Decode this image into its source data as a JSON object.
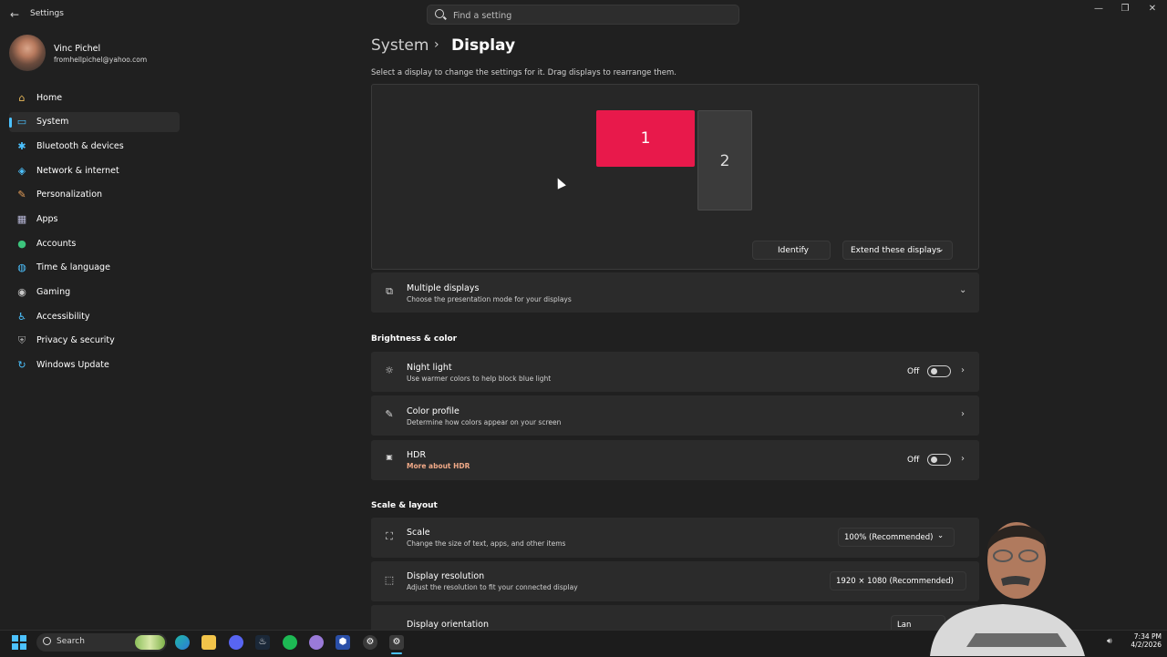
{
  "app": {
    "title": "Settings"
  },
  "search": {
    "placeholder": "Find a setting"
  },
  "user": {
    "name": "Vinc Pichel",
    "email": "fromhellpichel@yahoo.com"
  },
  "nav": [
    {
      "label": "Home",
      "icon": "home-icon"
    },
    {
      "label": "System",
      "icon": "system-icon",
      "active": true
    },
    {
      "label": "Bluetooth & devices",
      "icon": "bluetooth-icon"
    },
    {
      "label": "Network & internet",
      "icon": "wifi-icon"
    },
    {
      "label": "Personalization",
      "icon": "brush-icon"
    },
    {
      "label": "Apps",
      "icon": "apps-icon"
    },
    {
      "label": "Accounts",
      "icon": "accounts-icon"
    },
    {
      "label": "Time & language",
      "icon": "globe-icon"
    },
    {
      "label": "Gaming",
      "icon": "gamepad-icon"
    },
    {
      "label": "Accessibility",
      "icon": "accessibility-icon"
    },
    {
      "label": "Privacy & security",
      "icon": "shield-icon"
    },
    {
      "label": "Windows Update",
      "icon": "update-icon"
    }
  ],
  "breadcrumb": {
    "parent": "System",
    "separator": "›",
    "current": "Display"
  },
  "display_hint": "Select a display to change the settings for it. Drag displays to rearrange them.",
  "monitors": [
    {
      "label": "1",
      "selected": true
    },
    {
      "label": "2",
      "selected": false
    }
  ],
  "identify_label": "Identify",
  "extend_label": "Extend these displays",
  "multiple_displays": {
    "title": "Multiple displays",
    "subtitle": "Choose the presentation mode for your displays"
  },
  "sections": {
    "brightness": "Brightness & color",
    "scale_layout": "Scale & layout"
  },
  "night_light": {
    "title": "Night light",
    "subtitle": "Use warmer colors to help block blue light",
    "state": "Off"
  },
  "color_profile": {
    "title": "Color profile",
    "subtitle": "Determine how colors appear on your screen"
  },
  "hdr": {
    "title": "HDR",
    "link": "More about HDR",
    "state": "Off"
  },
  "scale": {
    "title": "Scale",
    "subtitle": "Change the size of text, apps, and other items",
    "value": "100% (Recommended)"
  },
  "resolution": {
    "title": "Display resolution",
    "subtitle": "Adjust the resolution to fit your connected display",
    "value": "1920 × 1080 (Recommended)"
  },
  "orientation": {
    "title": "Display orientation",
    "value": "Lan"
  },
  "taskbar": {
    "search_label": "Search",
    "apps": [
      "edge-icon",
      "file-explorer-icon",
      "discord-icon",
      "steam-icon",
      "spotify-icon",
      "app-icon",
      "app2-icon",
      "app3-icon",
      "settings-icon"
    ],
    "time": "7:34 PM",
    "date": "4/2/2026"
  },
  "colors": {
    "accent": "#4cc2ff",
    "monitor_selected": "#e8194b",
    "background": "#202020",
    "card": "#2b2b2b"
  }
}
